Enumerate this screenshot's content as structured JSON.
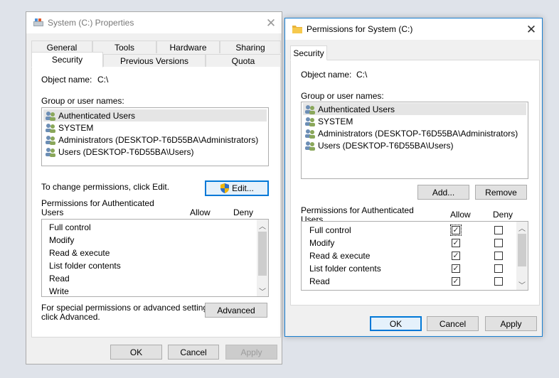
{
  "props": {
    "title": "System (C:) Properties",
    "tabs_top": [
      "General",
      "Tools",
      "Hardware",
      "Sharing"
    ],
    "tabs_bottom": [
      "Security",
      "Previous Versions",
      "Quota"
    ],
    "object_label": "Object name:",
    "object_value": "C:\\",
    "group_label": "Group or user names:",
    "users": [
      "Authenticated Users",
      "SYSTEM",
      "Administrators (DESKTOP-T6D55BA\\Administrators)",
      "Users (DESKTOP-T6D55BA\\Users)"
    ],
    "change_text": "To change permissions, click Edit.",
    "edit_label": "Edit...",
    "perms_label_1": "Permissions for Authenticated",
    "perms_label_2": "Users",
    "allow_label": "Allow",
    "deny_label": "Deny",
    "perms": [
      "Full control",
      "Modify",
      "Read & execute",
      "List folder contents",
      "Read",
      "Write"
    ],
    "special_1": "For special permissions or advanced settings,",
    "special_2": "click Advanced.",
    "advanced_label": "Advanced",
    "ok_label": "OK",
    "cancel_label": "Cancel",
    "apply_label": "Apply"
  },
  "perm_dialog": {
    "title": "Permissions for System (C:)",
    "tab": "Security",
    "object_label": "Object name:",
    "object_value": "C:\\",
    "group_label": "Group or user names:",
    "users": [
      "Authenticated Users",
      "SYSTEM",
      "Administrators (DESKTOP-T6D55BA\\Administrators)",
      "Users (DESKTOP-T6D55BA\\Users)"
    ],
    "add_label": "Add...",
    "remove_label": "Remove",
    "perms_label_1": "Permissions for Authenticated",
    "perms_label_2": "Users",
    "allow_label": "Allow",
    "deny_label": "Deny",
    "perms": [
      {
        "name": "Full control",
        "allow": true,
        "deny": false
      },
      {
        "name": "Modify",
        "allow": true,
        "deny": false
      },
      {
        "name": "Read & execute",
        "allow": true,
        "deny": false
      },
      {
        "name": "List folder contents",
        "allow": true,
        "deny": false
      },
      {
        "name": "Read",
        "allow": true,
        "deny": false
      }
    ],
    "ok_label": "OK",
    "cancel_label": "Cancel",
    "apply_label": "Apply"
  },
  "icons": {
    "drive": "drive-icon",
    "folder": "folder-icon",
    "user_group": "user-group-icon",
    "shield": "uac-shield-icon",
    "check": "✓"
  },
  "colors": {
    "accent": "#0078d7",
    "selection": "#e5e5e5",
    "folder": "#f6c94d"
  }
}
